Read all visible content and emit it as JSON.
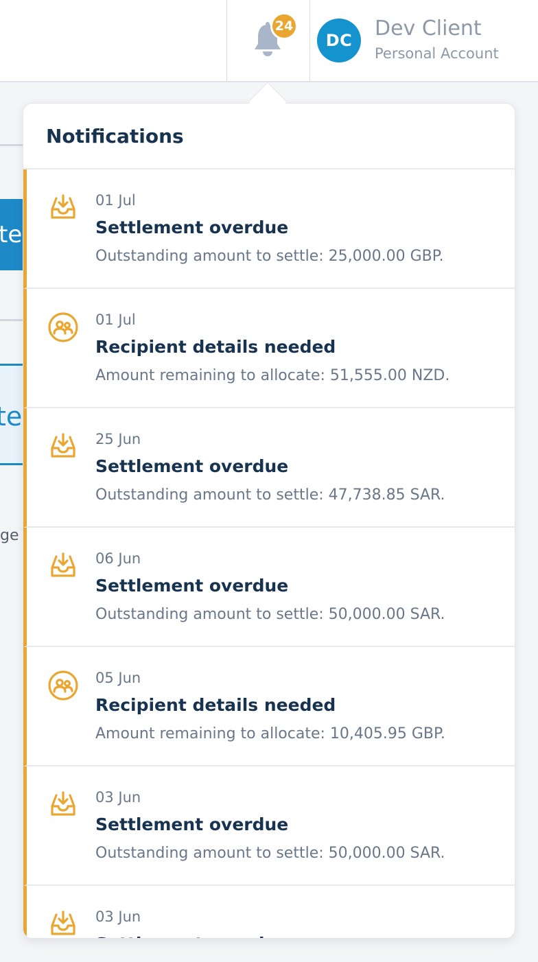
{
  "header": {
    "notification_count": "24",
    "avatar_initials": "DC",
    "user_name": "Dev Client",
    "account_type": "Personal Account"
  },
  "background": {
    "button_primary_fragment": "te",
    "button_secondary_fragment": "te",
    "text_fragment": "ge c"
  },
  "notifications": {
    "title": "Notifications",
    "items": [
      {
        "date": "01 Jul",
        "title": "Settlement overdue",
        "description": "Outstanding amount to settle: 25,000.00 GBP.",
        "icon": "inbox-download-icon"
      },
      {
        "date": "01 Jul",
        "title": "Recipient details needed",
        "description": "Amount remaining to allocate: 51,555.00 NZD.",
        "icon": "recipients-icon"
      },
      {
        "date": "25 Jun",
        "title": "Settlement overdue",
        "description": "Outstanding amount to settle: 47,738.85 SAR.",
        "icon": "inbox-download-icon"
      },
      {
        "date": "06 Jun",
        "title": "Settlement overdue",
        "description": "Outstanding amount to settle: 50,000.00 SAR.",
        "icon": "inbox-download-icon"
      },
      {
        "date": "05 Jun",
        "title": "Recipient details needed",
        "description": "Amount remaining to allocate: 10,405.95 GBP.",
        "icon": "recipients-icon"
      },
      {
        "date": "03 Jun",
        "title": "Settlement overdue",
        "description": "Outstanding amount to settle: 50,000.00 SAR.",
        "icon": "inbox-download-icon"
      },
      {
        "date": "03 Jun",
        "title": "Settlement overdue",
        "description": "",
        "icon": "inbox-download-icon"
      }
    ]
  },
  "colors": {
    "accent_orange": "#e9a630",
    "avatar_blue": "#1593cf",
    "title_dark": "#17334f",
    "muted_text": "#69778a"
  }
}
